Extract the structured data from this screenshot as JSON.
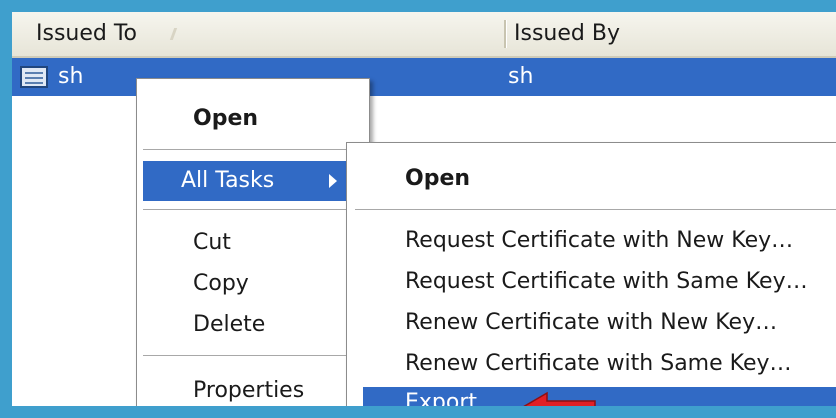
{
  "columns": {
    "issued_to": "Issued To",
    "issued_by": "Issued By"
  },
  "row": {
    "issued_to": "sh",
    "issued_by": "sh"
  },
  "context_menu": {
    "open": "Open",
    "all_tasks": "All Tasks",
    "cut": "Cut",
    "copy": "Copy",
    "delete": "Delete",
    "properties": "Properties"
  },
  "submenu": {
    "open": "Open",
    "items": [
      "Request Certificate with New Key…",
      "Request Certificate with Same Key…",
      "Renew Certificate with New Key…",
      "Renew Certificate with Same Key…",
      "Export…"
    ]
  },
  "colors": {
    "selection": "#316ac5",
    "background": "#3f9fcd",
    "annotation_arrow": "#e11f26"
  }
}
